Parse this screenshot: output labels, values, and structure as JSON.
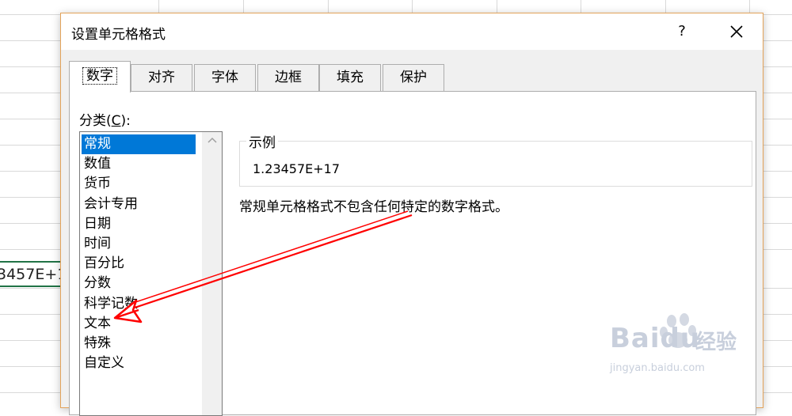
{
  "sheet": {
    "cell_text": "3457E+1"
  },
  "dialog": {
    "title": "设置单元格格式",
    "help_label": "?",
    "tabs": [
      {
        "label": "数字",
        "active": true
      },
      {
        "label": "对齐",
        "active": false
      },
      {
        "label": "字体",
        "active": false
      },
      {
        "label": "边框",
        "active": false
      },
      {
        "label": "填充",
        "active": false
      },
      {
        "label": "保护",
        "active": false
      }
    ],
    "category_label_pre": "分类(",
    "category_label_key": "C",
    "category_label_post": "):",
    "categories": [
      "常规",
      "数值",
      "货币",
      "会计专用",
      "日期",
      "时间",
      "百分比",
      "分数",
      "科学记数",
      "文本",
      "特殊",
      "自定义"
    ],
    "selected_category": "常规",
    "sample_label": "示例",
    "sample_value": "1.23457E+17",
    "description": "常规单元格格式不包含任何特定的数字格式。"
  },
  "annotation": {
    "color": "#ff0000"
  },
  "watermark": {
    "brand": "Bai",
    "brand2": "du",
    "cn": "经验",
    "url": "jingyan.baidu.com"
  }
}
